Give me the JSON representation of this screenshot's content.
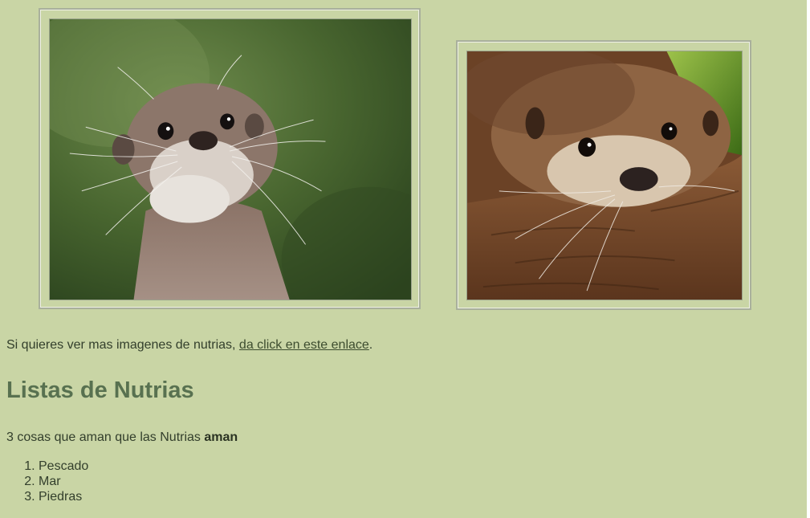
{
  "intro": {
    "text_before": "Si quieres ver mas imagenes de nutrias, ",
    "link_text": "da click en este enlace",
    "text_after": "."
  },
  "section": {
    "heading": "Listas de Nutrias",
    "paragraph_prefix": "3 cosas que aman que las Nutrias ",
    "paragraph_bold": "aman",
    "list_items": [
      "Pescado",
      "Mar",
      "Piedras"
    ]
  },
  "colors": {
    "page_background": "#c9d5a5",
    "heading": "#587150",
    "text": "#333f2c",
    "frame_border": "#a9b09c"
  }
}
